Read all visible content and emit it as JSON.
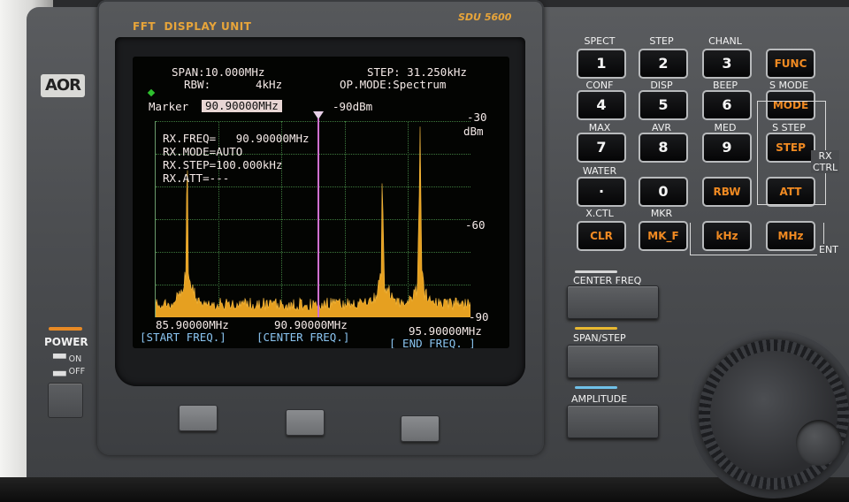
{
  "device": {
    "brand": "AOR",
    "unit_title": "FFT",
    "unit_subtitle": "DISPLAY UNIT",
    "model": "SDU 5600"
  },
  "lcd": {
    "span_label": "SPAN:",
    "span_value": "10.000MHz",
    "rbw_label": "RBW:",
    "rbw_value": "4kHz",
    "step_label": "STEP:",
    "step_value": "31.250kHz",
    "opmode_label": "OP.MODE:",
    "opmode_value": "Spectrum",
    "marker_label": "Marker",
    "marker_value": "90.90000MHz",
    "marker_level": "-90dBm",
    "ref_top": "-30",
    "ref_unit": "dBm",
    "ref_mid": "-60",
    "ref_bottom": "-90",
    "rx_freq": "RX.FREQ=   90.90000MHz",
    "rx_mode": "RX.MODE=AUTO",
    "rx_step": "RX.STEP=100.000kHz",
    "rx_att": "RX.ATT=---",
    "start_freq": "85.90000MHz",
    "center_freq": "90.90000MHz",
    "end_freq": "95.90000MHz",
    "start_label": "[START FREQ.]",
    "center_label": "[CENTER FREQ.]",
    "end_label": "[ END FREQ. ]"
  },
  "spectrum": {
    "freq_range_mhz": [
      85.9,
      95.9
    ],
    "level_range_dbm": [
      -90,
      -30
    ],
    "marker_mhz": 90.9,
    "peaks": [
      {
        "freq_mhz": 86.9,
        "level_dbm": -51
      },
      {
        "freq_mhz": 93.1,
        "level_dbm": -56
      },
      {
        "freq_mhz": 94.3,
        "level_dbm": -42
      }
    ],
    "trace_color": "#e6a020",
    "marker_color": "#d070d0",
    "grid_color": "#3e7a3e"
  },
  "power": {
    "label": "POWER",
    "on_label": "ON",
    "off_label": "OFF"
  },
  "keypad": {
    "rows": [
      [
        {
          "label": "SPECT",
          "key": "1"
        },
        {
          "label": "STEP",
          "key": "2"
        },
        {
          "label": "CHANL",
          "key": "3"
        },
        {
          "label": "",
          "key": "FUNC"
        }
      ],
      [
        {
          "label": "CONF",
          "key": "4"
        },
        {
          "label": "DISP",
          "key": "5"
        },
        {
          "label": "BEEP",
          "key": "6"
        },
        {
          "label": "S MODE",
          "key": "MODE"
        }
      ],
      [
        {
          "label": "MAX",
          "key": "7"
        },
        {
          "label": "AVR",
          "key": "8"
        },
        {
          "label": "MED",
          "key": "9"
        },
        {
          "label": "S STEP",
          "key": "STEP"
        }
      ],
      [
        {
          "label": "WATER",
          "key": "·"
        },
        {
          "label": "",
          "key": "0"
        },
        {
          "label": "",
          "key": "RBW"
        },
        {
          "label": "",
          "key": "ATT"
        }
      ],
      [
        {
          "label": "X.CTL",
          "key": "CLR"
        },
        {
          "label": "MKR",
          "key": "MK_F"
        },
        {
          "label": "",
          "key": "kHz"
        },
        {
          "label": "",
          "key": "MHz"
        }
      ]
    ],
    "rx_ctrl_label": "RX\nCTRL",
    "ent_label": "ENT"
  },
  "big_keys": {
    "center_freq": "CENTER FREQ",
    "span_step": "SPAN/STEP",
    "amplitude": "AMPLITUDE"
  }
}
